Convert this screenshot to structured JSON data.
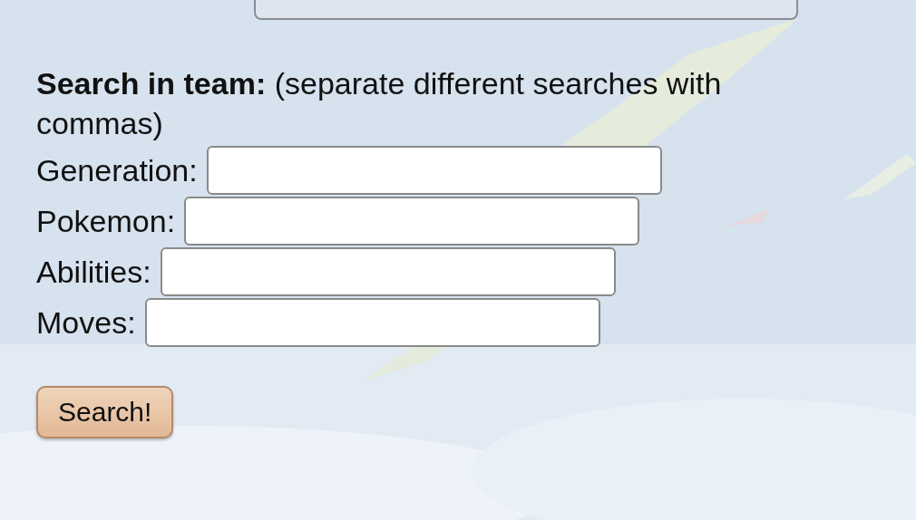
{
  "search_panel": {
    "heading": "**Search in team:** (separate different searches with commas)",
    "fields": [
      {
        "label": "Generation:"
      },
      {
        "label": "Pokemon:"
      },
      {
        "label": "Abilities:"
      },
      {
        "label": "Moves:"
      }
    ],
    "button": "Search!"
  }
}
